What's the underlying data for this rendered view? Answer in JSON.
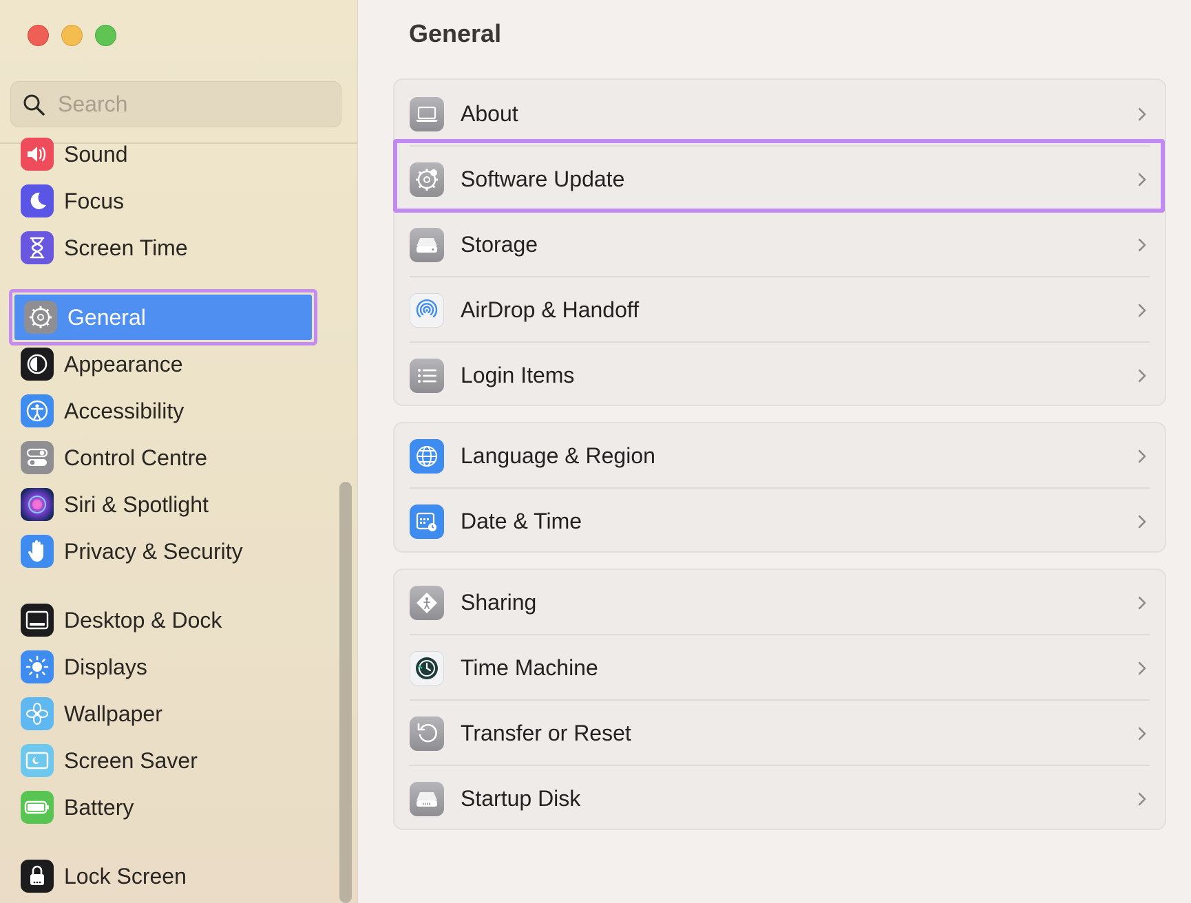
{
  "window": {
    "controls": [
      "close",
      "minimize",
      "zoom"
    ]
  },
  "search": {
    "placeholder": "Search",
    "value": ""
  },
  "sidebar": {
    "items": [
      {
        "label": "Sound",
        "icon": "sound-icon",
        "color": "#ee4b5b"
      },
      {
        "label": "Focus",
        "icon": "moon-icon",
        "color": "#5b55e6"
      },
      {
        "label": "Screen Time",
        "icon": "hourglass-icon",
        "color": "#6a57e0"
      },
      {
        "label": "General",
        "icon": "gear-icon",
        "color": "#8e8e93",
        "selected": true
      },
      {
        "label": "Appearance",
        "icon": "appearance-icon",
        "color": "#1c1c1e"
      },
      {
        "label": "Accessibility",
        "icon": "accessibility-icon",
        "color": "#3f8cf0"
      },
      {
        "label": "Control Centre",
        "icon": "toggles-icon",
        "color": "#8e8e93"
      },
      {
        "label": "Siri & Spotlight",
        "icon": "siri-icon",
        "color": "#7a3fd0"
      },
      {
        "label": "Privacy & Security",
        "icon": "hand-icon",
        "color": "#3f8cf0"
      },
      {
        "label": "Desktop & Dock",
        "icon": "dock-icon",
        "color": "#1c1c1e"
      },
      {
        "label": "Displays",
        "icon": "sun-icon",
        "color": "#3f8cf0"
      },
      {
        "label": "Wallpaper",
        "icon": "flower-icon",
        "color": "#5fb8f0"
      },
      {
        "label": "Screen Saver",
        "icon": "screensaver-icon",
        "color": "#6ec8ee"
      },
      {
        "label": "Battery",
        "icon": "battery-icon",
        "color": "#58c553"
      },
      {
        "label": "Lock Screen",
        "icon": "lock-icon",
        "color": "#1c1c1e"
      }
    ]
  },
  "main": {
    "title": "General",
    "groups": [
      [
        {
          "label": "About",
          "icon": "laptop-icon"
        },
        {
          "label": "Software Update",
          "icon": "gear-badge-icon",
          "highlighted": true
        },
        {
          "label": "Storage",
          "icon": "drive-icon"
        },
        {
          "label": "AirDrop & Handoff",
          "icon": "airdrop-icon"
        },
        {
          "label": "Login Items",
          "icon": "list-icon"
        }
      ],
      [
        {
          "label": "Language & Region",
          "icon": "globe-icon"
        },
        {
          "label": "Date & Time",
          "icon": "calendar-clock-icon"
        }
      ],
      [
        {
          "label": "Sharing",
          "icon": "sharing-icon"
        },
        {
          "label": "Time Machine",
          "icon": "time-machine-icon"
        },
        {
          "label": "Transfer or Reset",
          "icon": "reset-icon"
        },
        {
          "label": "Startup Disk",
          "icon": "startup-disk-icon"
        }
      ]
    ]
  },
  "colors": {
    "selection": "#4f8ff2",
    "highlight_outline": "#c18af2"
  }
}
